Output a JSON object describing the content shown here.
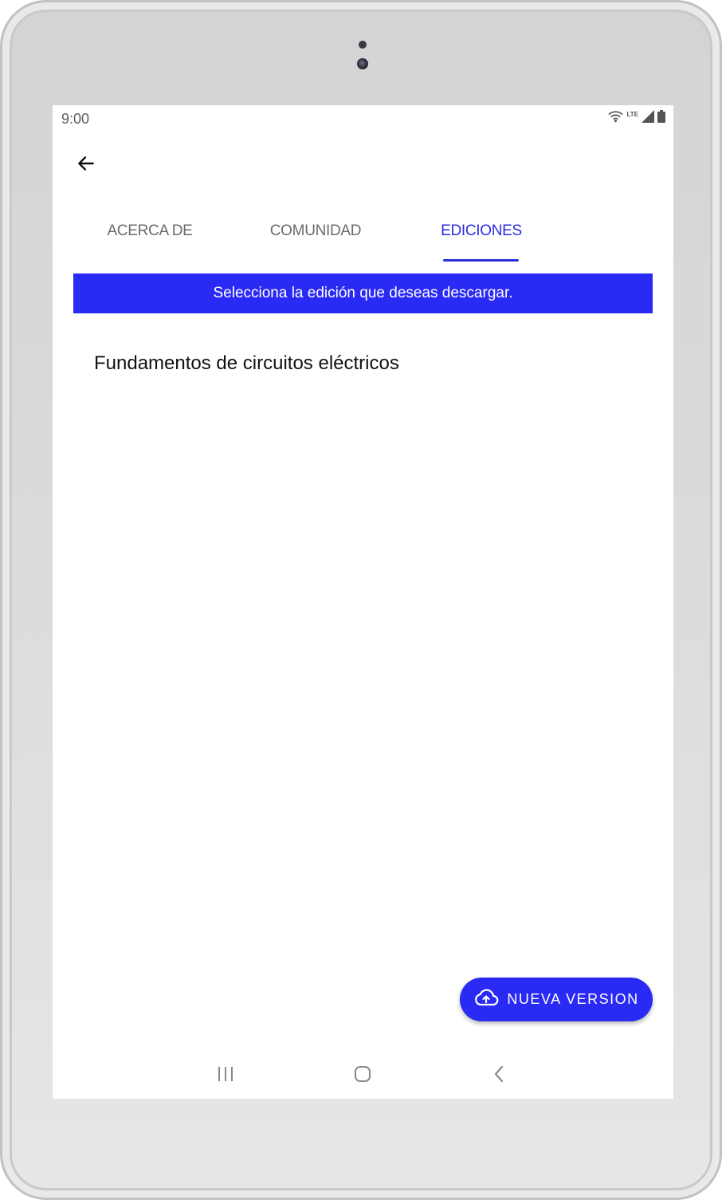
{
  "status_bar": {
    "time": "9:00",
    "network_label": "LTE",
    "icons": [
      "wifi-icon",
      "signal-icon",
      "battery-icon"
    ]
  },
  "toolbar": {
    "back_icon": "arrow-left-icon"
  },
  "tabs": [
    {
      "label": "ACERCA DE",
      "active": false
    },
    {
      "label": "COMUNIDAD",
      "active": false
    },
    {
      "label": "EDICIONES",
      "active": true
    }
  ],
  "banner": {
    "text": "Selecciona la edición que deseas descargar."
  },
  "editions": [
    {
      "title": "Fundamentos de circuitos eléctricos"
    }
  ],
  "fab": {
    "label": "NUEVA VERSION",
    "icon": "cloud-upload-icon"
  },
  "navigation": {
    "icons": [
      "recent-apps-icon",
      "home-icon",
      "back-nav-icon"
    ]
  },
  "colors": {
    "accent": "#2a2af5",
    "tab_active": "#2a2ee0",
    "tab_inactive": "#6b6b6b"
  }
}
